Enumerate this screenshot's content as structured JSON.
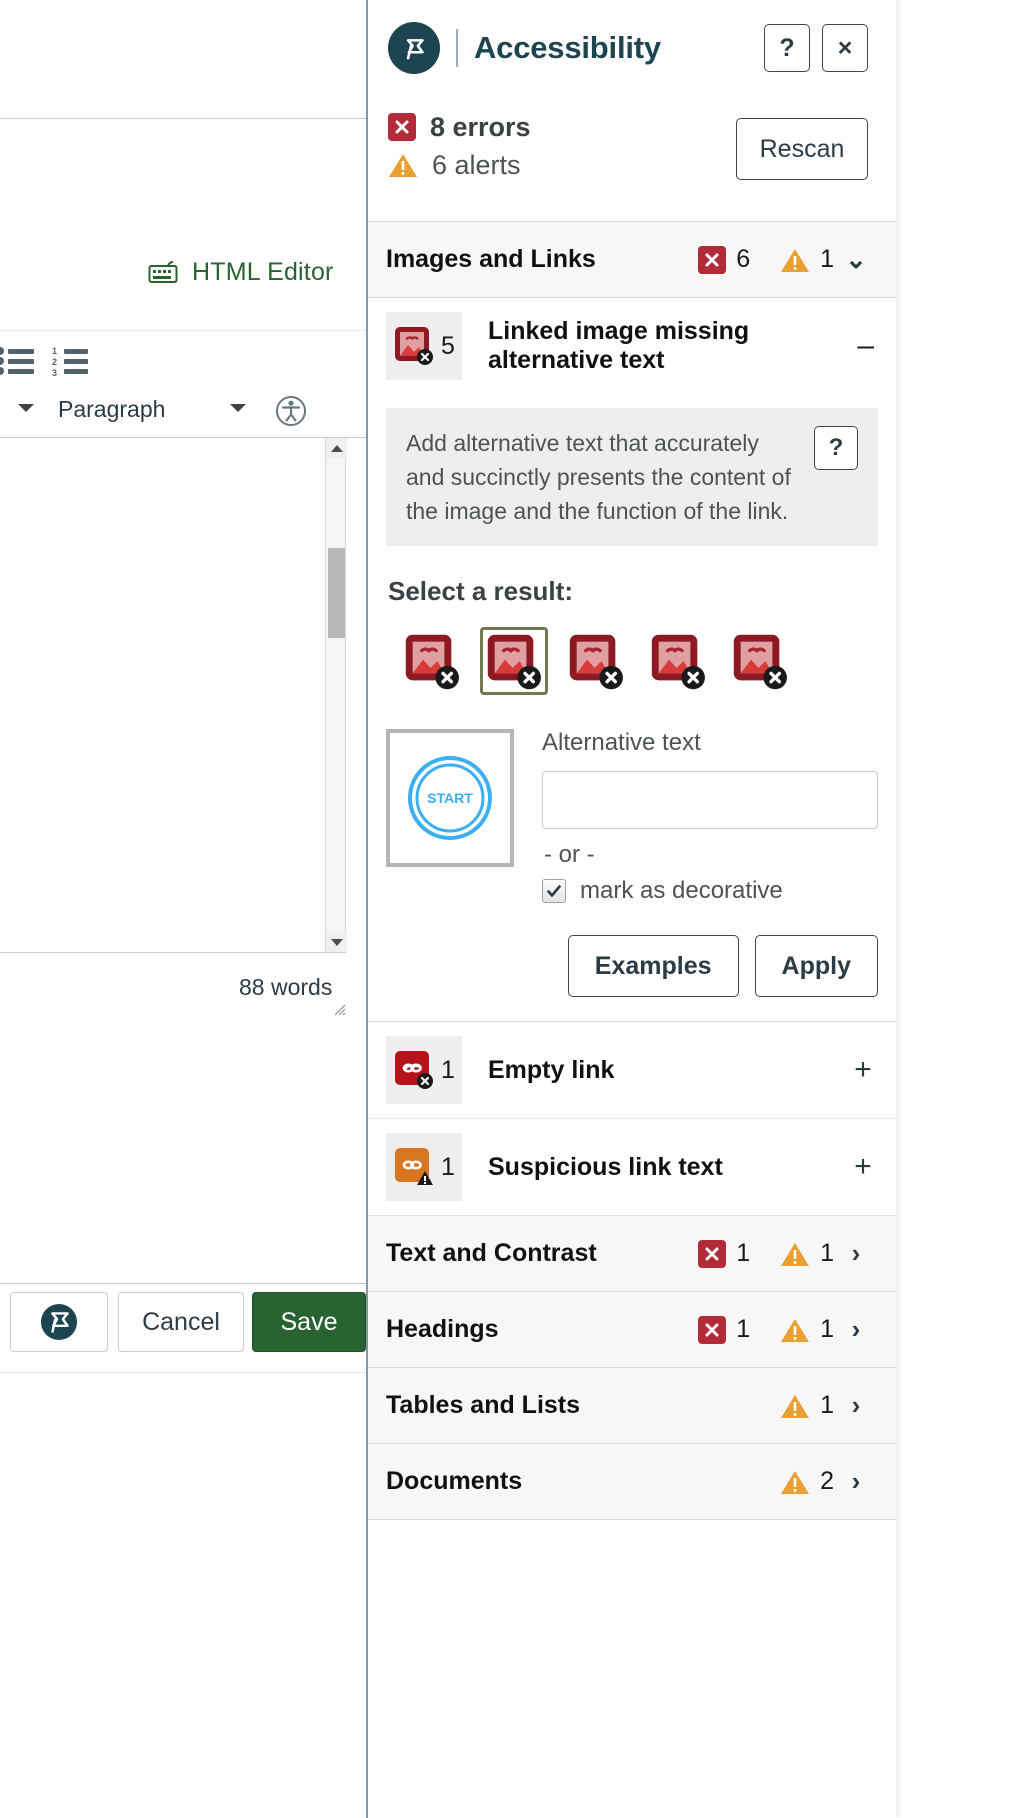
{
  "editor": {
    "html_editor_label": "HTML Editor",
    "html_editor_icon": "keyboard-icon",
    "bullet_list_icon": "unordered-list-icon",
    "numbered_list_icon": "ordered-list-icon",
    "block_format_label": "Paragraph",
    "block_format_caret_icon": "chevron-down-icon",
    "accessibility_checker_icon": "accessibility-person-icon",
    "word_count": "88 words",
    "scrollbar_up_icon": "scroll-up-arrow-icon",
    "scrollbar_down_icon": "scroll-down-arrow-icon",
    "resize_grip_icon": "resize-grip-icon",
    "footer": {
      "a11y_button_icon": "pope-tech-logo-icon",
      "cancel_label": "Cancel",
      "save_label": "Save"
    }
  },
  "panel": {
    "title": "Accessibility",
    "logo_icon": "pope-tech-flag-logo",
    "help_button_label": "?",
    "close_button_label": "×",
    "errors_count": "8 errors",
    "alerts_count": "6 alerts",
    "error_icon": "error-x-icon",
    "alert_icon": "warning-triangle-icon",
    "rescan_label": "Rescan",
    "sections": [
      {
        "title": "Images and Links",
        "errors": "6",
        "alerts": "1",
        "expanded": true,
        "chevron": "⌄",
        "chevron_icon": "chevron-down-icon"
      },
      {
        "title": "Text and Contrast",
        "errors": "1",
        "alerts": "1",
        "expanded": false,
        "chevron": "›",
        "chevron_icon": "chevron-right-icon"
      },
      {
        "title": "Headings",
        "errors": "1",
        "alerts": "1",
        "expanded": false,
        "chevron": "›",
        "chevron_icon": "chevron-right-icon"
      },
      {
        "title": "Tables and Lists",
        "errors": null,
        "alerts": "1",
        "expanded": false,
        "chevron": "›",
        "chevron_icon": "chevron-right-icon"
      },
      {
        "title": "Documents",
        "errors": null,
        "alerts": "2",
        "expanded": false,
        "chevron": "›",
        "chevron_icon": "chevron-right-icon"
      }
    ],
    "open_issue": {
      "count": "5",
      "label": "Linked image missing alternative text",
      "icon": "linked-image-error-icon",
      "collapse_glyph": "–",
      "help_text": "Add alternative text that accurately and succinctly presents the content of the image and the function of the link.",
      "help_button_label": "?",
      "select_result_label": "Select a result:",
      "results": [
        {
          "icon": "linked-image-error-thumb",
          "selected": false
        },
        {
          "icon": "linked-image-error-thumb",
          "selected": true
        },
        {
          "icon": "linked-image-error-thumb",
          "selected": false
        },
        {
          "icon": "linked-image-error-thumb",
          "selected": false
        },
        {
          "icon": "linked-image-error-thumb",
          "selected": false
        }
      ],
      "preview_label": "START",
      "preview_icon": "start-button-image",
      "alt_text_label": "Alternative text",
      "alt_text_value": "",
      "alt_text_placeholder": "",
      "or_label": "- or -",
      "decorative_label": "mark as decorative",
      "decorative_checked": true,
      "examples_label": "Examples",
      "apply_label": "Apply"
    },
    "sub_issues": [
      {
        "count": "1",
        "label": "Empty link",
        "icon": "empty-link-error-icon",
        "severity": "error",
        "toggle": "+"
      },
      {
        "count": "1",
        "label": "Suspicious link text",
        "icon": "suspicious-link-alert-icon",
        "severity": "alert",
        "toggle": "+"
      }
    ]
  },
  "colors": {
    "error_red": "#b32b38",
    "alert_orange": "#e8a033",
    "brand_navy": "#1d4451",
    "save_green": "#2a6332",
    "link_green": "#2a6332",
    "selected_olive": "#6e7a52"
  }
}
